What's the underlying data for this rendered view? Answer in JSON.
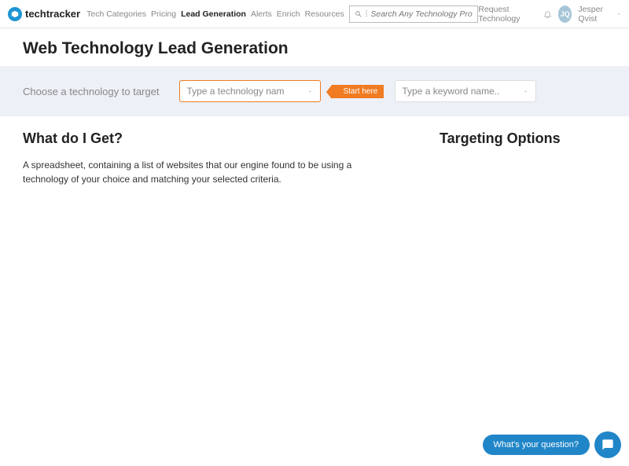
{
  "header": {
    "logo_text": "techtracker",
    "nav": [
      "Tech Categories",
      "Pricing",
      "Lead Generation",
      "Alerts",
      "Enrich",
      "Resources"
    ],
    "active_nav_index": 2,
    "search_placeholder": "Search Any Technology Product",
    "request_tech": "Request Technology",
    "user_initials": "JQ",
    "user_name": "Jesper Qvist"
  },
  "page_title": "Web Technology Lead Generation",
  "filter": {
    "label": "Choose a technology to target",
    "tech_placeholder": "Type a technology nam",
    "start_here": "Start here",
    "keyword_placeholder": "Type a keyword name.."
  },
  "sections": {
    "what_title": "What do I Get?",
    "what_body": "A spreadsheet, containing a list of websites that our engine found to be using a technology of your choice and matching your selected criteria.",
    "targeting_title": "Targeting Options"
  },
  "chat": {
    "question": "What's your question?"
  }
}
